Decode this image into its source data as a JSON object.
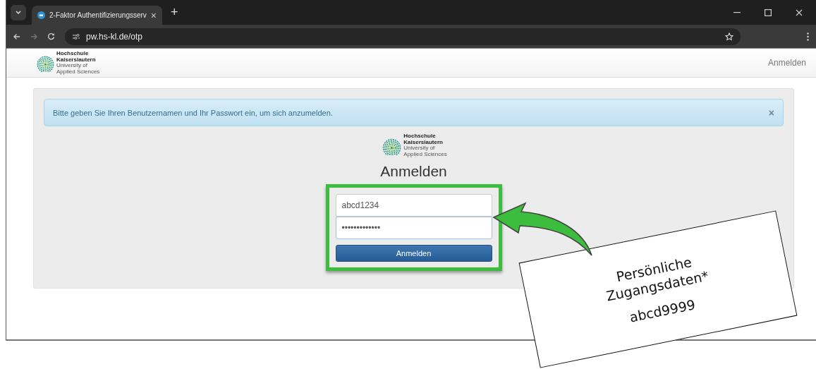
{
  "browser": {
    "tab": {
      "title": "2-Faktor Authentifizierungsserv",
      "close": "×"
    },
    "new_tab": "+",
    "url": "pw.hs-kl.de/otp"
  },
  "header": {
    "logo_lines": [
      "Hochschule",
      "Kaiserslautern",
      "University of",
      "Applied Sciences"
    ],
    "nav_link": "Anmelden"
  },
  "alert": {
    "message": "Bitte geben Sie Ihren Benutzernamen und Ihr Passwort ein, um sich anzumelden.",
    "close": "×"
  },
  "login": {
    "logo_lines": [
      "Hochschule",
      "Kaiserslautern",
      "University of",
      "Applied Sciences"
    ],
    "title": "Anmelden",
    "username": "abcd1234",
    "password": "•••••••••••••",
    "submit": "Anmelden"
  },
  "annotation": {
    "lines": [
      "Persönliche",
      "Zugangsdaten*",
      "abcd9999"
    ]
  }
}
